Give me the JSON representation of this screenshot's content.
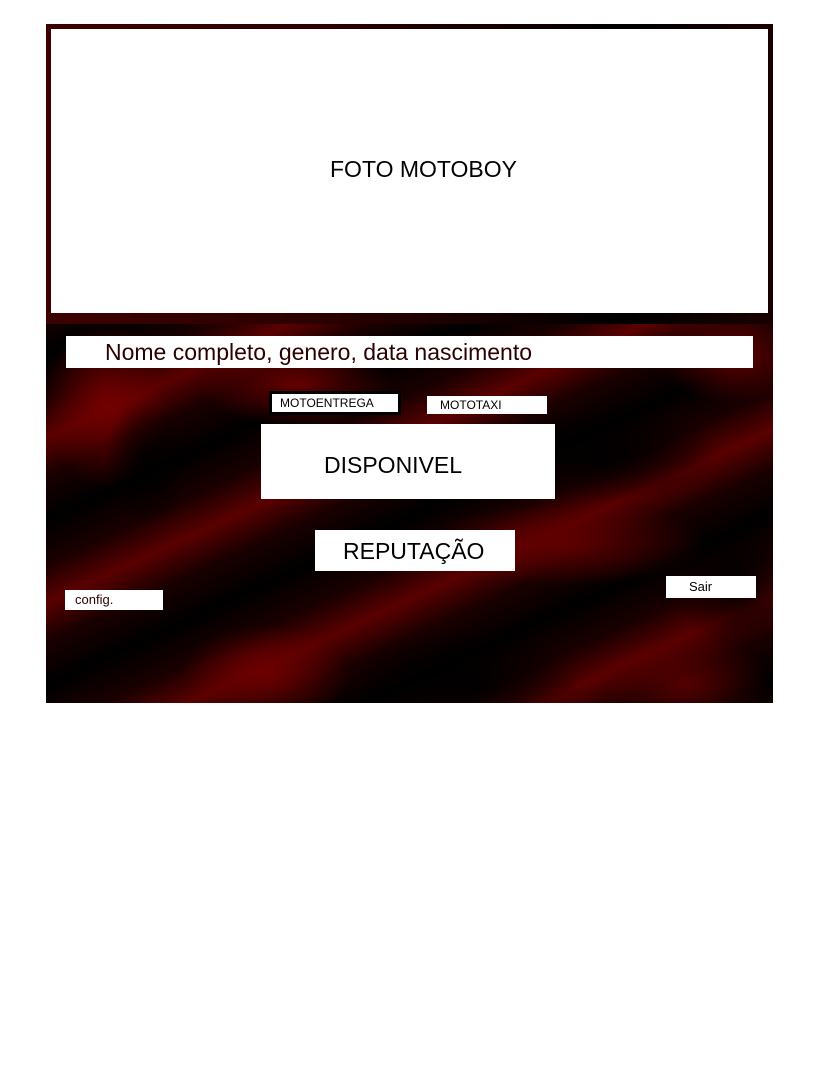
{
  "profile": {
    "photo_label": "FOTO MOTOBOY",
    "info_text": "Nome completo, genero, data nascimento"
  },
  "modes": {
    "entrega_label": "MOTOENTREGA",
    "taxi_label": "MOTOTAXI"
  },
  "status": {
    "availability_label": "DISPONIVEL",
    "reputation_label": "REPUTAÇÃO"
  },
  "actions": {
    "config_label": "config.",
    "logout_label": "Sair"
  },
  "colors": {
    "background_dark": "#000000",
    "background_accent": "#5a0000",
    "panel": "#ffffff"
  }
}
